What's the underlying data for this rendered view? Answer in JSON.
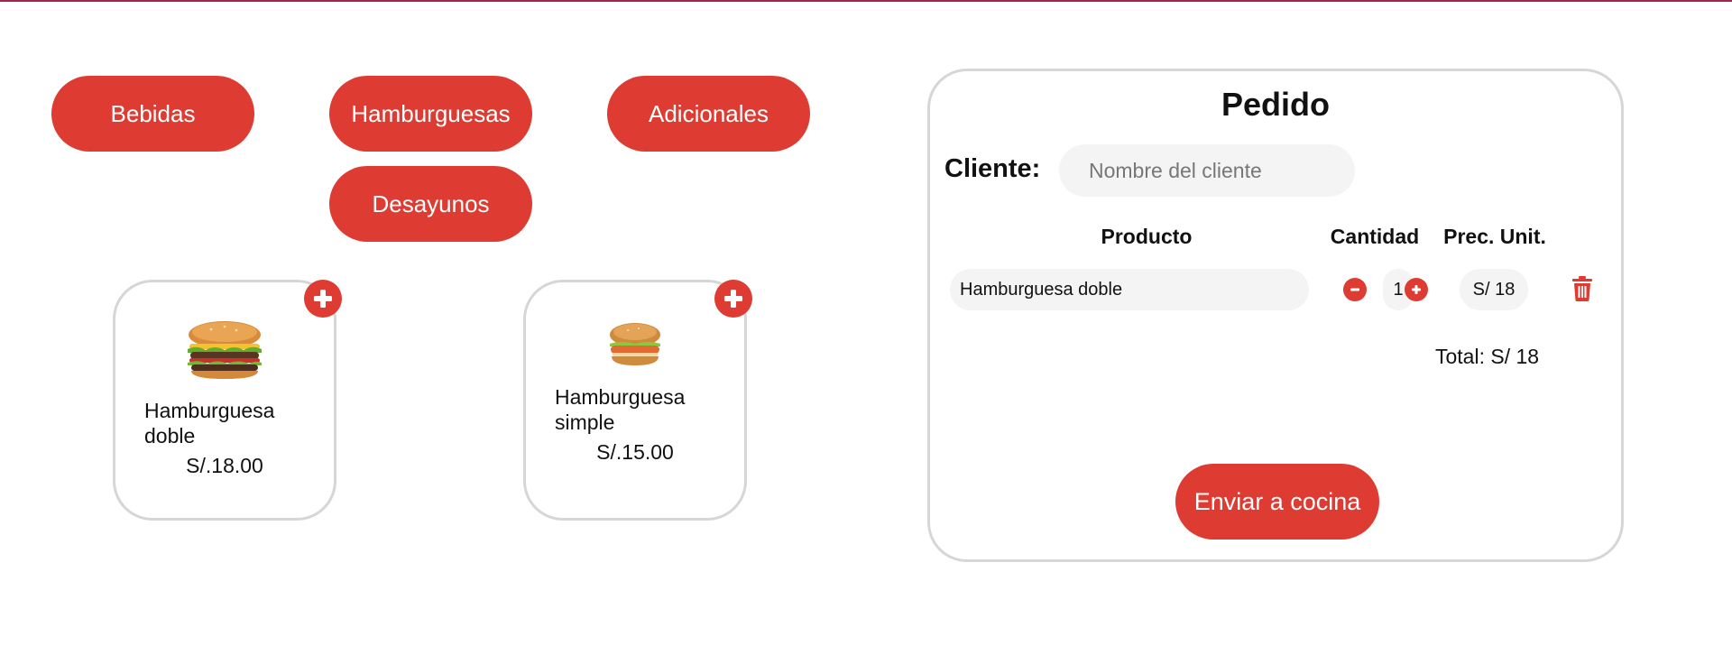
{
  "categories": {
    "bebidas": "Bebidas",
    "hamburguesas": "Hamburguesas",
    "adicionales": "Adicionales",
    "desayunos": "Desayunos"
  },
  "products": [
    {
      "name": "Hamburguesa doble",
      "price": "S/.18.00",
      "icon": "double-burger-image"
    },
    {
      "name": "Hamburguesa simple",
      "price": "S/.15.00",
      "icon": "chicken-burger-image"
    }
  ],
  "order": {
    "title": "Pedido",
    "client_label": "Cliente:",
    "client_placeholder": "Nombre del cliente",
    "client_value": "",
    "columns": {
      "product": "Producto",
      "quantity": "Cantidad",
      "unit_price": "Prec. Unit."
    },
    "items": [
      {
        "product": "Hamburguesa doble",
        "quantity": "1",
        "unit_price": "S/ 18"
      }
    ],
    "total": "Total: S/ 18",
    "send_label": "Enviar a cocina"
  },
  "colors": {
    "accent": "#de3b32",
    "border": "#d6d6d6",
    "field_bg": "#f4f4f4",
    "top_line": "#a3234f"
  }
}
